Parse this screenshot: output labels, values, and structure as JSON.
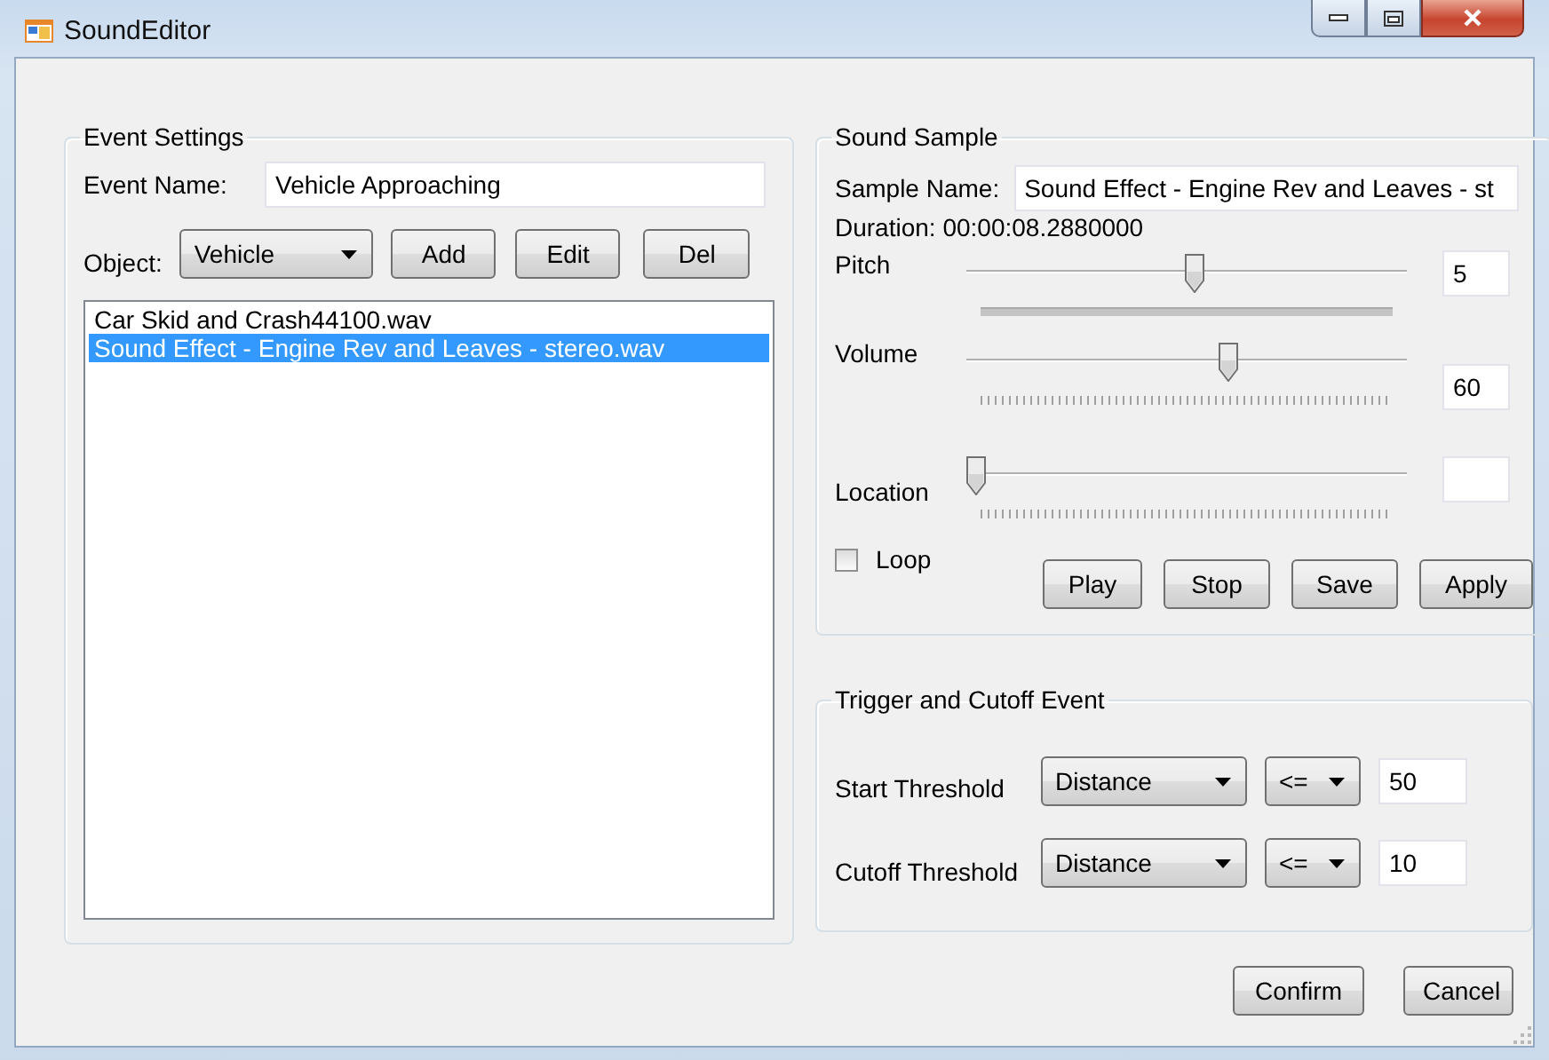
{
  "window": {
    "title": "SoundEditor"
  },
  "event_settings": {
    "title": "Event Settings",
    "event_name": {
      "label": "Event Name:",
      "value": "Vehicle Approaching"
    },
    "object": {
      "label": "Object:",
      "value": "Vehicle"
    },
    "buttons": [
      "Add",
      "Edit",
      "Del"
    ],
    "files": [
      {
        "name": "Car Skid and Crash44100.wav",
        "selected": false
      },
      {
        "name": "Sound Effect - Engine Rev and Leaves - stereo.wav",
        "selected": true
      }
    ]
  },
  "sound_sample": {
    "title": "Sound Sample",
    "sample_name": {
      "label": "Sample Name:",
      "value": "Sound Effect - Engine Rev and Leaves - st"
    },
    "duration": "Duration: 00:00:08.2880000",
    "sliders": [
      {
        "label": "Pitch",
        "kind": "bar",
        "level": 0.52,
        "value": "5"
      },
      {
        "label": "Volume",
        "kind": "ticks",
        "level": 0.6,
        "value": "60"
      },
      {
        "label": "Location",
        "kind": "ticks",
        "level": 0
      }
    ],
    "loop": {
      "label": "Loop",
      "checked": false
    },
    "buttons": [
      "Play",
      "Stop",
      "Save",
      "Apply"
    ]
  },
  "trigger": {
    "title": "Trigger and Cutoff Event",
    "rows": [
      {
        "label": "Start Threshold",
        "measure": "Distance",
        "operator": "<=",
        "value": "50"
      },
      {
        "label": "Cutoff Threshold",
        "measure": "Distance",
        "operator": "<=",
        "value": "10"
      }
    ]
  },
  "buttons": [
    "Confirm",
    "Cancel"
  ]
}
